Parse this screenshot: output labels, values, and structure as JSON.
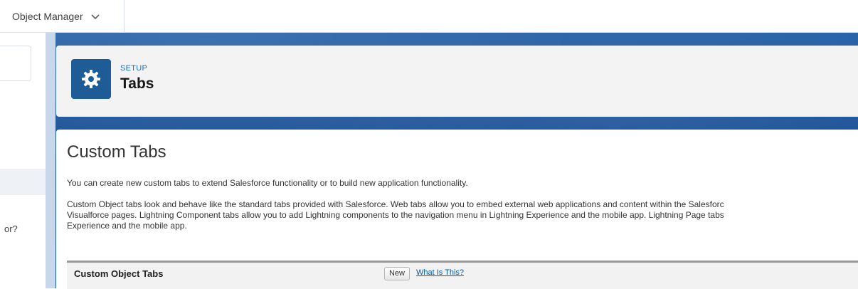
{
  "topnav": {
    "item_label": "Object Manager"
  },
  "sidebar": {
    "partial_text": "or?"
  },
  "header": {
    "eyebrow": "SETUP",
    "title": "Tabs"
  },
  "content": {
    "title": "Custom Tabs",
    "intro": "You can create new custom tabs to extend Salesforce functionality or to build new application functionality.",
    "details": [
      "Custom Object tabs look and behave like the standard tabs provided with Salesforce. Web tabs allow you to embed external web applications and content within the Salesforc",
      "Visualforce pages. Lightning Component tabs allow you to add Lightning components to the navigation menu in Lightning Experience and the mobile app. Lightning Page tabs",
      "Experience and the mobile app."
    ]
  },
  "section": {
    "title": "Custom Object Tabs",
    "new_label": "New",
    "help_link": "What Is This?"
  },
  "colors": {
    "brand_blue": "#1b5297",
    "icon_bg": "#1e5c97",
    "link": "#015ba7"
  }
}
